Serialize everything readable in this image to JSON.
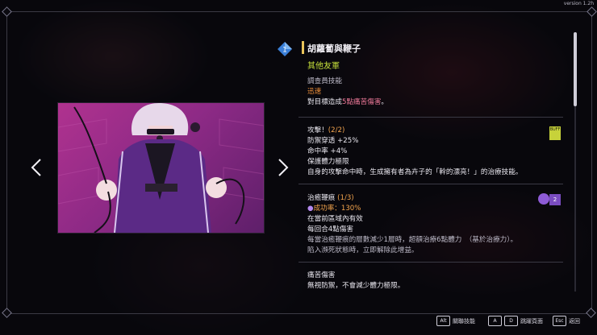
{
  "version": "version 1.2h",
  "character": {
    "level": "1",
    "name": "胡蘿蔔與鞭子",
    "faction": "其他友軍"
  },
  "skill_type": "調查員技能",
  "speed": {
    "label": "迅速",
    "desc_prefix": "對目標造成",
    "desc_highlight": "5點痛苦傷害",
    "desc_suffix": "。"
  },
  "attack": {
    "label_prefix": "攻擊！",
    "count": "(2/2)",
    "lines": [
      "防禦穿透 +25%",
      "命中率 +4%",
      "保護體力極限"
    ],
    "desc": "自身的攻擊命中時，生成擁有者為卉子的「幹的漂亮！」的治療技能。",
    "badge_text": "BUFF"
  },
  "heal_whip": {
    "label": "治癒鞭痕",
    "count": "(1/3)",
    "success_label": "成功率：130%",
    "lines": [
      "在當前區域內有效",
      "每回合4點傷害"
    ],
    "desc1": "每當治癒鞭痕的層數減少1層時，超額治療6點體力　（基於治療力）。",
    "desc2": "陷入瀕死狀態時，立即解除此增益。",
    "badge_num": "2"
  },
  "pain": {
    "label": "痛苦傷害",
    "desc": "無視防禦，不會減少體力極限。"
  },
  "footer": {
    "hint1_key": "Alt",
    "hint1_label": "關聯技能",
    "hint2_keys": [
      "A",
      "D"
    ],
    "hint2_label": "跳躍頁面",
    "hint3_key": "Esc",
    "hint3_label": "返回"
  },
  "colors": {
    "faction": "#c6e03b",
    "speed": "#f0913a",
    "damage": "#f07a9a",
    "title_bar": "#e9c45a"
  }
}
